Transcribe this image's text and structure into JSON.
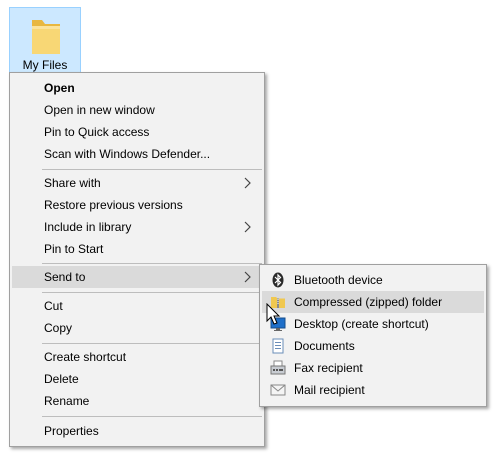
{
  "desktop": {
    "folder_label": "My Files"
  },
  "context_menu": {
    "items": [
      {
        "label": "Open"
      },
      {
        "label": "Open in new window"
      },
      {
        "label": "Pin to Quick access"
      },
      {
        "label": "Scan with Windows Defender..."
      },
      {
        "label": "Share with"
      },
      {
        "label": "Restore previous versions"
      },
      {
        "label": "Include in library"
      },
      {
        "label": "Pin to Start"
      },
      {
        "label": "Send to"
      },
      {
        "label": "Cut"
      },
      {
        "label": "Copy"
      },
      {
        "label": "Create shortcut"
      },
      {
        "label": "Delete"
      },
      {
        "label": "Rename"
      },
      {
        "label": "Properties"
      }
    ]
  },
  "send_to_menu": {
    "items": [
      {
        "label": "Bluetooth device",
        "icon": "bluetooth-icon"
      },
      {
        "label": "Compressed (zipped) folder",
        "icon": "zip-folder-icon"
      },
      {
        "label": "Desktop (create shortcut)",
        "icon": "desktop-icon"
      },
      {
        "label": "Documents",
        "icon": "documents-icon"
      },
      {
        "label": "Fax recipient",
        "icon": "fax-icon"
      },
      {
        "label": "Mail recipient",
        "icon": "mail-icon"
      }
    ]
  },
  "colors": {
    "menu_bg": "#f2f2f2",
    "hover_bg": "#dadada",
    "selection_bg": "#cce8ff",
    "folder_yellow": "#f8d775"
  }
}
